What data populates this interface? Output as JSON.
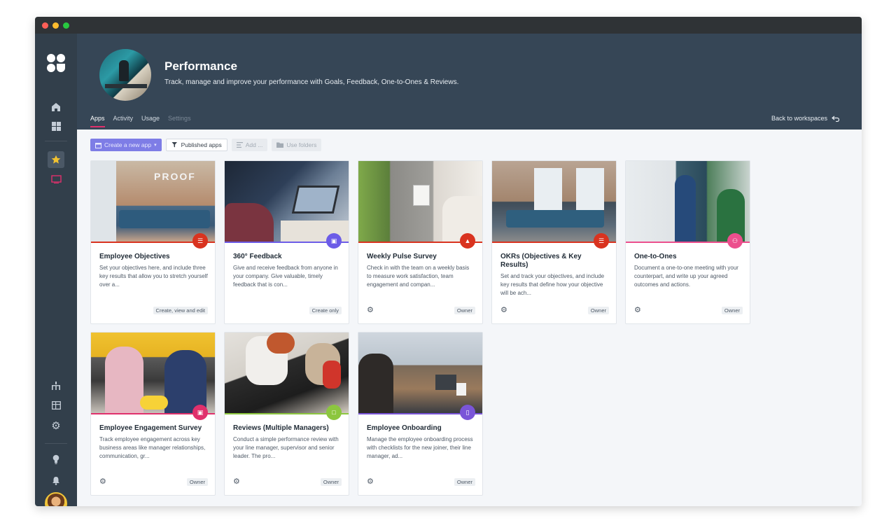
{
  "header": {
    "title": "Performance",
    "subtitle": "Track, manage and improve your performance with Goals, Feedback, One-to-Ones & Reviews.",
    "tabs": [
      "Apps",
      "Activity",
      "Usage",
      "Settings"
    ],
    "back_label": "Back to workspaces"
  },
  "toolbar": {
    "create_label": "Create a new app",
    "published_label": "Published apps",
    "add_label": "Add ...",
    "folders_label": "Use folders"
  },
  "colors": {
    "accent": "#e0306c",
    "header_bg": "#364656",
    "sidebar_bg": "#323f4b"
  },
  "cards": [
    {
      "title": "Employee Objectives",
      "desc": "Set your objectives here, and include three key results that allow you to stretch yourself over a...",
      "tag": "Create, view and edit",
      "color": "#d9331f",
      "icon": "list-icon",
      "gear": false
    },
    {
      "title": "360° Feedback",
      "desc": "Give and receive feedback from anyone in your company. Give valuable, timely feedback that is con...",
      "tag": "Create only",
      "color": "#6c5ce7",
      "icon": "presentation-icon",
      "gear": false
    },
    {
      "title": "Weekly Pulse Survey",
      "desc": "Check in with the team on a weekly basis to measure work satisfaction, team engagement and compan...",
      "tag": "Owner",
      "color": "#d9331f",
      "icon": "bell-icon",
      "gear": true
    },
    {
      "title": "OKRs (Objectives & Key Results)",
      "desc": "Set and track your objectives, and include key results that define how your objective will be ach...",
      "tag": "Owner",
      "color": "#d9331f",
      "icon": "list-icon",
      "gear": true
    },
    {
      "title": "One-to-Ones",
      "desc": "Document a one-to-one meeting with your counterpart, and write up your agreed outcomes and actions.",
      "tag": "Owner",
      "color": "#ec4f8d",
      "icon": "chat-icon",
      "gear": true
    },
    {
      "title": "Employee Engagement Survey",
      "desc": "Track employee engagement across key business areas like manager relationships, communication, gr...",
      "tag": "Owner",
      "color": "#e0306c",
      "icon": "image-icon",
      "gear": true
    },
    {
      "title": "Reviews (Multiple Managers)",
      "desc": "Conduct a simple performance review with your line manager, supervisor and senior leader. The pro...",
      "tag": "Owner",
      "color": "#8cc63f",
      "icon": "comment-icon",
      "gear": true
    },
    {
      "title": "Employee Onboarding",
      "desc": "Manage the employee onboarding process with checklists for the new joiner, their line manager, ad...",
      "tag": "Owner",
      "color": "#7a55d8",
      "icon": "trash-icon",
      "gear": true
    }
  ]
}
